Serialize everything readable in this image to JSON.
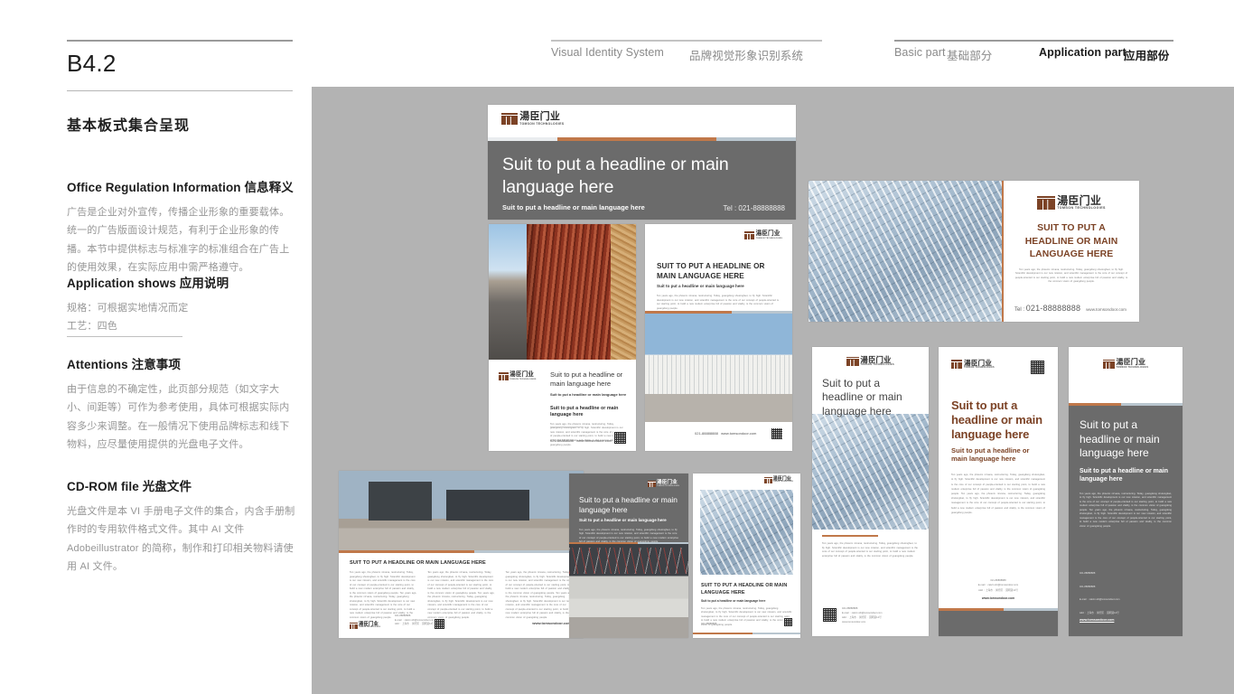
{
  "header": {
    "nav": {
      "visual_identity_en": "Visual Identity System",
      "visual_identity_cn": "品牌视觉形象识别系统",
      "basic_part_en": "Basic part",
      "basic_part_cn": "基础部分",
      "application_part_en": "Application part",
      "application_part_cn": "应用部份"
    }
  },
  "sidebar": {
    "page_code": "B4.2",
    "section_title": "基本板式集合呈现",
    "blocks": [
      {
        "heading": "Office Regulation Information 信息释义",
        "body": "广告是企业对外宣传，传播企业形象的重要载体。统一的广告版面设计规范，有利于企业形象的传播。本节中提供标志与标准字的标准组合在广告上的使用效果，在实际应用中需严格遵守。"
      },
      {
        "heading": "Application shows 应用说明",
        "body": "规格：可根据实地情况而定\n工艺：四色"
      },
      {
        "heading": "Attentions 注意事项",
        "body": "由于信息的不确定性，此页部分规范（如文字大小、间距等）可作为参考使用，具体可根据实际内容多少来调整。在一般情况下使用品牌标志和线下物料，应尽量使用提供的光盘电子文件。"
      },
      {
        "heading": "CD-ROM file 光盘文件",
        "body": "光盘文件是本 VI 手册电子文件的集合，内含手册制作时的专用软件格式文件。其中 AI 文件 Adobeillustrator 的简称，制作和打印相关物料请使用 AI 文件。"
      }
    ]
  },
  "brand": {
    "logo_cn": "湯臣门业",
    "logo_en": "TOMSON TECHNOLOGIES",
    "accent_color": "#c0784a",
    "logo_mark_color": "#7c4326",
    "gray_color": "#6b6b6b",
    "canvas_color": "#b3b3b3"
  },
  "common": {
    "headline_sentence": "Suit to put a headline or main language here",
    "headline_caps": "SUIT TO PUT A HEADLINE OR MAIN LANGUAGE HERE",
    "subline": "Suit to put a headline or main language here",
    "body_copy": "Ten years ago, the phoenix nirvana, restructuring. Today, guangdong shutongfeet, to fly high. Scientific development is our new mission, and scientific management is the core of our concept of people-oriented is our starting point, to build a new modern enterprise full of passion and vitality, is the common vision of guangdong people.",
    "body_copy_long": "Ten years ago, the phoenix nirvana, restructuring. Today, guangdong shutongfeet, to fly high. Scientific development is our new mission, and scientific management is the core of our concept of people-oriented is our starting point, to build a new modern enterprise full of passion and vitality, is the common vision of guangdong people. Ten years ago, the phoenix nirvana, restructuring. Today, guangdong shutongfeet, to fly high. Scientific development is our new mission, and scientific management is the core of our concept of people-oriented is our starting point, to build a new modern enterprise full of passion and vitality, is the common vision of guangdong people.",
    "tel_label": "Tel :",
    "tel_number": "021-88888888",
    "fax_label": "Fax :",
    "fax_number": "021-88888888",
    "email": "E-mail : calvin.shi@tomsondoor.com",
    "address": "Add : 上海市 · 闵行区 · 园明道12号",
    "website": "www.tomsondoor.com"
  },
  "artefacts": {
    "cover": {
      "name": "Brochure cover",
      "headline": "Suit to put a headline or main\nlanguage here",
      "subline": "Suit to put a headline or main language here",
      "tel": "Tel : 021-88888888"
    },
    "poster_red": {
      "name": "Red corrugated door poster"
    },
    "poster_white": {
      "name": "White sectional doors poster"
    },
    "landscape_card": {
      "name": "Glass facade landscape card"
    },
    "banner_1": {
      "name": "Roll-up banner — photo"
    },
    "banner_2": {
      "name": "Roll-up banner — white"
    },
    "banner_3": {
      "name": "Roll-up banner — gray"
    },
    "spread": {
      "name": "Three column spread"
    },
    "gray_card": {
      "name": "Warehouse interior card"
    },
    "small_poster": {
      "name": "Glass facade small poster"
    }
  }
}
